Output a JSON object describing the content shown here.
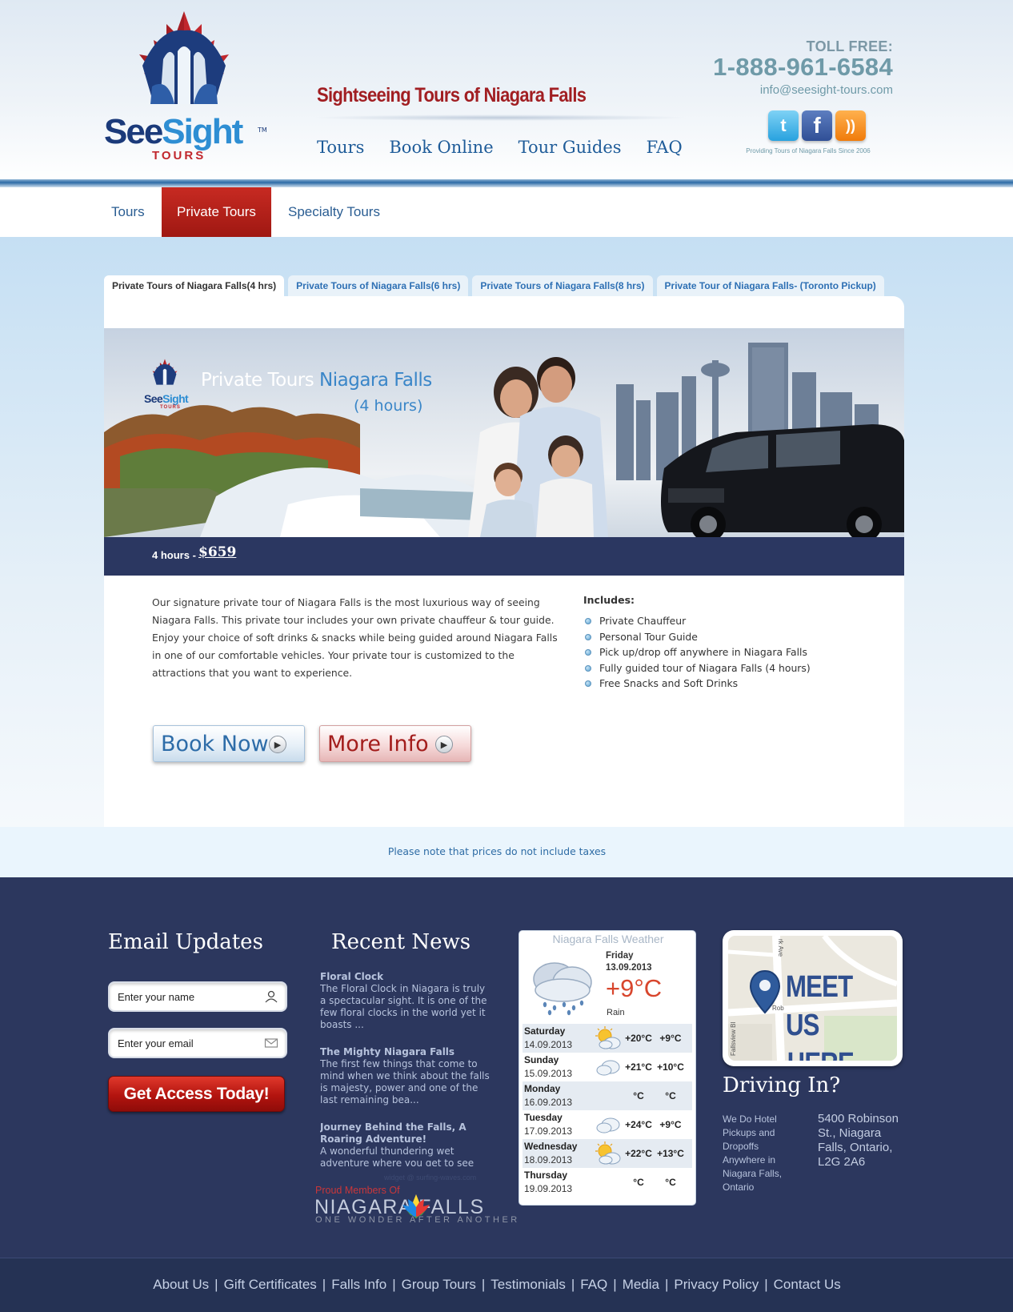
{
  "header": {
    "logo_word_a": "See",
    "logo_word_b": "Sight",
    "logo_tm": "TM",
    "logo_sub": "TOURS",
    "tagline": "Sightseeing Tours of Niagara Falls",
    "nav": [
      "Tours",
      "Book Online",
      "Tour Guides",
      "FAQ"
    ],
    "toll_free_label": "TOLL FREE:",
    "phone": "1-888-961-6584",
    "email": "info@seesight-tours.com",
    "social": [
      "twitter-icon",
      "facebook-icon",
      "rss-icon"
    ],
    "since": "Providing Tours of Niagara Falls Since 2006"
  },
  "subnav": {
    "items": [
      "Tours",
      "Private Tours",
      "Specialty Tours"
    ],
    "active": "Private Tours"
  },
  "tour_tabs": [
    "Private Tours of Niagara Falls(4 hrs)",
    "Private Tours of Niagara Falls(6 hrs)",
    "Private Tours of Niagara Falls(8 hrs)",
    "Private Tour of Niagara Falls- (Toronto Pickup)"
  ],
  "banner": {
    "logo_word_a": "See",
    "logo_word_b": "Sight",
    "logo_sub": "TOURS",
    "title_a": "Private Tours",
    "title_b": "Niagara Falls",
    "subtitle": "(4 hours)"
  },
  "price": {
    "label": "4 hours -",
    "value": "$659"
  },
  "description": "Our signature private tour of Niagara Falls is the most luxurious way of seeing Niagara Falls. This private tour includes your own private chauffeur & tour guide. Enjoy your choice of soft drinks & snacks while being guided around Niagara Falls in one of our comfortable vehicles. Your private tour is customized to the attractions that you want to experience.",
  "includes": {
    "title": "Includes:",
    "items": [
      "Private Chauffeur",
      "Personal Tour Guide",
      "Pick up/drop off anywhere in Niagara Falls",
      "Fully guided tour of Niagara Falls (4 hours)",
      "Free Snacks and Soft Drinks"
    ]
  },
  "buttons": {
    "book": "Book Now",
    "more": "More Info"
  },
  "note": "Please note that prices do not include taxes",
  "email_updates": {
    "title": "Email Updates",
    "name_placeholder": "Enter your name",
    "email_placeholder": "Enter your email",
    "cta": "Get Access Today!"
  },
  "recent_news": {
    "title": "Recent News",
    "items": [
      {
        "title": "Floral Clock",
        "text": "The Floral Clock in Niagara is truly a spectacular sight. It is one of the few floral clocks in the world yet it boasts ..."
      },
      {
        "title": "The Mighty Niagara Falls",
        "text": "The first few things that come to mind when we think about the falls is majesty, power and one of the last remaining bea..."
      },
      {
        "title": "Journey Behind the Falls, A Roaring Adventure!",
        "text": "A wonderful thundering wet adventure where you get to see the falls closer"
      }
    ],
    "credit": "widget @ surfing-waves.com",
    "members_label": "Proud Members Of",
    "members_logo": "NIAGARA FALLS",
    "members_tagline": "ONE WONDER AFTER ANOTHER"
  },
  "weather": {
    "title": "Niagara Falls Weather",
    "today_day": "Friday",
    "today_date": "13.09.2013",
    "today_temp": "+9°C",
    "today_cond": "Rain",
    "days": [
      {
        "day": "Saturday",
        "date": "14.09.2013",
        "icon": "sun-cloud-icon",
        "hi": "+20°C",
        "lo": "+9°C"
      },
      {
        "day": "Sunday",
        "date": "15.09.2013",
        "icon": "cloud-icon",
        "hi": "+21°C",
        "lo": "+10°C"
      },
      {
        "day": "Monday",
        "date": "16.09.2013",
        "icon": "",
        "hi": "°C",
        "lo": "°C"
      },
      {
        "day": "Tuesday",
        "date": "17.09.2013",
        "icon": "cloud-icon",
        "hi": "+24°C",
        "lo": "+9°C"
      },
      {
        "day": "Wednesday",
        "date": "18.09.2013",
        "icon": "sun-cloud-icon",
        "hi": "+22°C",
        "lo": "+13°C"
      },
      {
        "day": "Thursday",
        "date": "19.09.2013",
        "icon": "",
        "hi": "°C",
        "lo": "°C"
      }
    ]
  },
  "map": {
    "text_a": "MEET US",
    "text_b": "HERE",
    "street_a": "rk Ave",
    "street_b": "Fallsview Bl",
    "street_c": "Rob"
  },
  "driving": {
    "title": "Driving In?",
    "left": "We Do Hotel Pickups and Dropoffs Anywhere in Niagara Falls, Ontario",
    "right": "5400 Robinson St., Niagara Falls, Ontario, L2G 2A6"
  },
  "footer_links": [
    "About Us",
    "Gift Certificates",
    "Falls Info",
    "Group Tours",
    "Testimonials",
    "FAQ",
    "Media",
    "Privacy Policy",
    "Contact Us"
  ]
}
